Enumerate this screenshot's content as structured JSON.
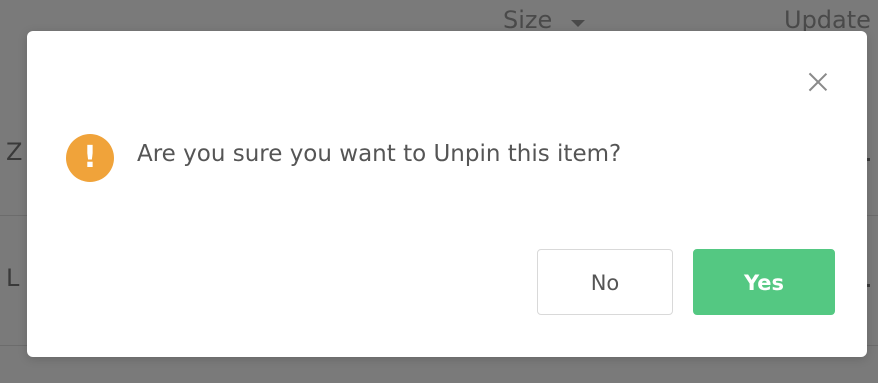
{
  "background": {
    "columns": {
      "size_label": "Size",
      "updated_label": "Update"
    },
    "row_fragments": [
      "Z",
      "L"
    ]
  },
  "dialog": {
    "message": "Are you sure you want to Unpin this item?",
    "icon": "exclamation-icon",
    "icon_glyph": "!",
    "buttons": {
      "no_label": "No",
      "yes_label": "Yes"
    }
  },
  "colors": {
    "overlay": "#7a7a7a",
    "warning": "#f0a33a",
    "primary": "#54c882",
    "text": "#555555"
  }
}
